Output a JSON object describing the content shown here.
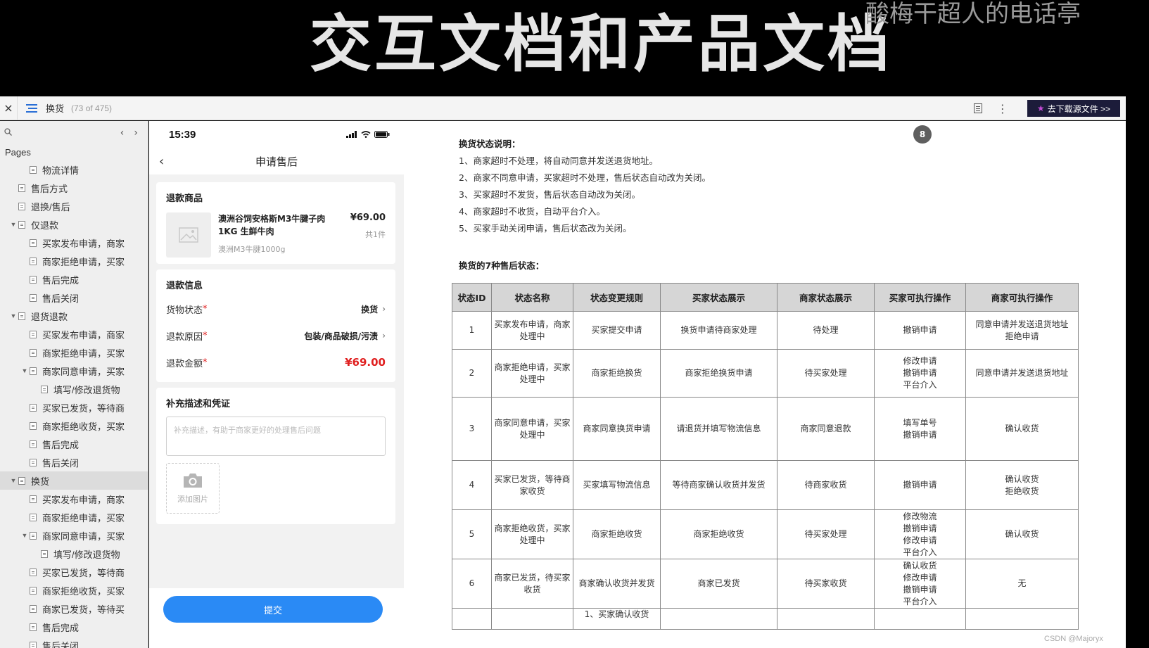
{
  "video": {
    "title": "交互文档和产品文档",
    "watermark": "酸梅干超人的电话亭",
    "credit": "CSDN @Majoryx"
  },
  "toolbar": {
    "close": "×",
    "page_name": "换货",
    "page_count": "(73 of 475)",
    "more": "⋮",
    "download": "去下载源文件 >>"
  },
  "sidebar": {
    "pages_label": "Pages",
    "items": [
      {
        "label": "物流详情",
        "level": 2,
        "caret": false
      },
      {
        "label": "售后方式",
        "level": 1,
        "caret": false
      },
      {
        "label": "退换/售后",
        "level": 1,
        "caret": false
      },
      {
        "label": "仅退款",
        "level": 1,
        "caret": true
      },
      {
        "label": "买家发布申请，商家",
        "level": 2,
        "caret": false
      },
      {
        "label": "商家拒绝申请，买家",
        "level": 2,
        "caret": false
      },
      {
        "label": "售后完成",
        "level": 2,
        "caret": false
      },
      {
        "label": "售后关闭",
        "level": 2,
        "caret": false
      },
      {
        "label": "退货退款",
        "level": 1,
        "caret": true
      },
      {
        "label": "买家发布申请，商家",
        "level": 2,
        "caret": false
      },
      {
        "label": "商家拒绝申请，买家",
        "level": 2,
        "caret": false
      },
      {
        "label": "商家同意申请，买家",
        "level": 2,
        "caret": true
      },
      {
        "label": "填写/修改退货物",
        "level": 3,
        "caret": false
      },
      {
        "label": "买家已发货，等待商",
        "level": 2,
        "caret": false
      },
      {
        "label": "商家拒绝收货，买家",
        "level": 2,
        "caret": false
      },
      {
        "label": "售后完成",
        "level": 2,
        "caret": false
      },
      {
        "label": "售后关闭",
        "level": 2,
        "caret": false
      },
      {
        "label": "换货",
        "level": 1,
        "caret": true,
        "selected": true
      },
      {
        "label": "买家发布申请，商家",
        "level": 2,
        "caret": false
      },
      {
        "label": "商家拒绝申请，买家",
        "level": 2,
        "caret": false
      },
      {
        "label": "商家同意申请，买家",
        "level": 2,
        "caret": true
      },
      {
        "label": "填写/修改退货物",
        "level": 3,
        "caret": false
      },
      {
        "label": "买家已发货，等待商",
        "level": 2,
        "caret": false
      },
      {
        "label": "商家拒绝收货，买家",
        "level": 2,
        "caret": false
      },
      {
        "label": "商家已发货，等待买",
        "level": 2,
        "caret": false
      },
      {
        "label": "售后完成",
        "level": 2,
        "caret": false
      },
      {
        "label": "售后关闭",
        "level": 2,
        "caret": false
      }
    ]
  },
  "phone": {
    "time": "15:39",
    "nav_title": "申请售后",
    "product_card": {
      "title": "退款商品",
      "name": "澳洲谷饲安格斯M3牛腱子肉1KG 生鲜牛肉",
      "spec": "澳洲M3牛腱1000g",
      "price": "¥69.00",
      "qty": "共1件"
    },
    "info_card": {
      "title": "退款信息",
      "rows": [
        {
          "label": "货物状态",
          "req": "*",
          "value": "换货"
        },
        {
          "label": "退款原因",
          "req": "*",
          "value": "包装/商品破损/污渍"
        }
      ],
      "amount_label": "退款金额",
      "amount_req": "*",
      "amount": "¥69.00"
    },
    "desc_card": {
      "title": "补充描述和凭证",
      "placeholder": "补充描述，有助于商家更好的处理售后问题",
      "upload_label": "添加图片"
    },
    "submit": "提交"
  },
  "doc": {
    "badge": "8",
    "heading1": "换货状态说明：",
    "lines": [
      "1、商家超时不处理，将自动同意并发送退货地址。",
      "2、商家不同意申请，买家超时不处理，售后状态自动改为关闭。",
      "3、买家超时不发货，售后状态自动改为关闭。",
      "4、商家超时不收货，自动平台介入。",
      "5、买家手动关闭申请，售后状态改为关闭。"
    ],
    "heading2": "换货的7种售后状态："
  },
  "table": {
    "headers": [
      "状态ID",
      "状态名称",
      "状态变更规则",
      "买家状态展示",
      "商家状态展示",
      "买家可执行操作",
      "商家可执行操作"
    ],
    "rows": [
      [
        "1",
        "买家发布申请，商家处理中",
        "买家提交申请",
        "换货申请待商家处理",
        "待处理",
        "撤销申请",
        "同意申请并发送退货地址\n拒绝申请"
      ],
      [
        "2",
        "商家拒绝申请，买家处理中",
        "商家拒绝换货",
        "商家拒绝换货申请",
        "待买家处理",
        "修改申请\n撤销申请\n平台介入",
        "同意申请并发送退货地址"
      ],
      [
        "3",
        "商家同意申请，买家处理中",
        "商家同意换货申请",
        "请退货并填写物流信息",
        "商家同意退款",
        "填写单号\n撤销申请",
        "确认收货"
      ],
      [
        "4",
        "买家已发货，等待商家收货",
        "买家填写物流信息",
        "等待商家确认收货并发货",
        "待商家收货",
        "撤销申请",
        "确认收货\n拒绝收货"
      ],
      [
        "5",
        "商家拒绝收货，买家处理中",
        "商家拒绝收货",
        "商家拒绝收货",
        "待买家处理",
        "修改物流\n撤销申请\n修改申请\n平台介入",
        "确认收货"
      ],
      [
        "6",
        "商家已发货，待买家收货",
        "商家确认收货并发货",
        "商家已发货",
        "待买家收货",
        "确认收货\n修改申请\n撤销申请\n平台介入",
        "无"
      ],
      [
        "",
        "",
        "1、买家确认收货",
        "",
        "",
        "",
        ""
      ]
    ]
  }
}
